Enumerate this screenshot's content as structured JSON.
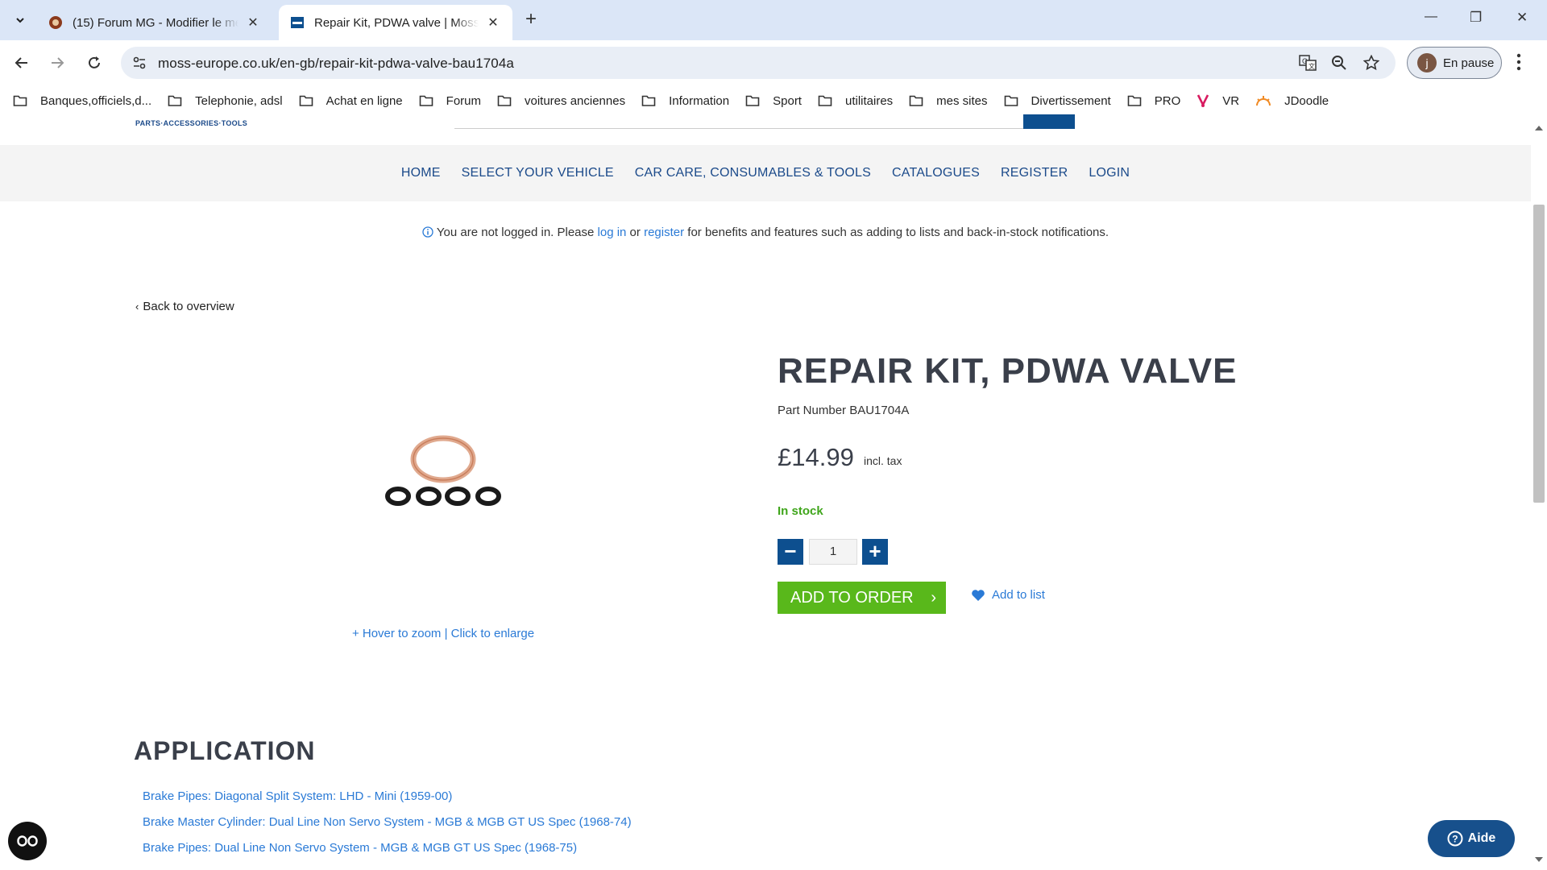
{
  "browser": {
    "tabs": [
      {
        "title": "(15) Forum MG - Modifier le message",
        "close": "✕"
      },
      {
        "title": "Repair Kit, PDWA valve | Moss Europe",
        "close": "✕"
      }
    ],
    "new_tab": "+",
    "window_controls": {
      "minimize": "—",
      "maximize": "❐",
      "close": "✕"
    },
    "url": "moss-europe.co.uk/en-gb/repair-kit-pdwa-valve-bau1704a",
    "profile": {
      "initial": "j",
      "label": "En pause"
    },
    "bookmarks": [
      {
        "label": "Banques,officiels,d...",
        "icon": "folder-icon"
      },
      {
        "label": "Telephonie, adsl",
        "icon": "folder-icon"
      },
      {
        "label": "Achat en ligne",
        "icon": "folder-icon"
      },
      {
        "label": "Forum",
        "icon": "folder-icon"
      },
      {
        "label": "voitures anciennes",
        "icon": "folder-icon"
      },
      {
        "label": "Information",
        "icon": "folder-icon"
      },
      {
        "label": "Sport",
        "icon": "folder-icon"
      },
      {
        "label": "utilitaires",
        "icon": "folder-icon"
      },
      {
        "label": "mes sites",
        "icon": "folder-icon"
      },
      {
        "label": "Divertissement",
        "icon": "folder-icon"
      },
      {
        "label": "PRO",
        "icon": "folder-icon"
      },
      {
        "label": "VR",
        "icon": "vr-icon"
      },
      {
        "label": "JDoodle",
        "icon": "jdoodle-icon"
      }
    ]
  },
  "site": {
    "logo_tagline": "PARTS·ACCESSORIES·TOOLS",
    "nav": [
      "HOME",
      "SELECT YOUR VEHICLE",
      "CAR CARE, CONSUMABLES & TOOLS",
      "CATALOGUES",
      "REGISTER",
      "LOGIN"
    ],
    "notice": {
      "prefix": "You are not logged in. Please ",
      "login_link": "log in",
      "middle": " or ",
      "register_link": "register",
      "suffix": " for benefits and features such as adding to lists and back-in-stock notifications."
    },
    "back_link": "Back to overview",
    "product": {
      "title": "REPAIR KIT, PDWA VALVE",
      "part_number": "Part Number BAU1704A",
      "price": "£14.99",
      "tax_note": "incl. tax",
      "stock": "In stock",
      "quantity": "1",
      "minus": "−",
      "plus": "+",
      "add_to_order": "ADD TO ORDER",
      "add_arrow": "›",
      "add_to_list": "Add to list",
      "zoom_hint": "+ Hover to zoom | Click to enlarge"
    },
    "application": {
      "heading": "APPLICATION",
      "links": [
        "Brake Pipes: Diagonal Split System: LHD - Mini (1959-00)",
        "Brake Master Cylinder: Dual Line Non Servo System - MGB & MGB GT US Spec (1968-74)",
        "Brake Pipes: Dual Line Non Servo System - MGB & MGB GT US Spec (1968-75)"
      ]
    },
    "help_button": "Aide"
  },
  "colors": {
    "accent": "#0d4f8f",
    "link": "#2a7ad6",
    "stock": "#3fa51b",
    "add_button": "#59b81b"
  }
}
